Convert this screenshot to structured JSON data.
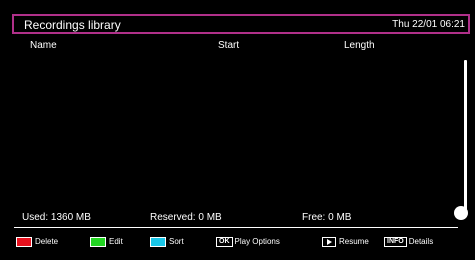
{
  "header": {
    "title": "Recordings library",
    "clock": "Thu 22/01 06:21"
  },
  "columns": {
    "name": "Name",
    "start": "Start",
    "length": "Length"
  },
  "recordings": [],
  "storage": {
    "used": "Used: 1360 MB",
    "reserved": "Reserved: 0 MB",
    "free": "Free: 0 MB"
  },
  "legend": {
    "delete": {
      "label": "Delete",
      "color": "#e8111e"
    },
    "edit": {
      "label": "Edit",
      "color": "#22d422"
    },
    "sort": {
      "label": "Sort",
      "color": "#19c6e8"
    },
    "play_options": {
      "key": "OK",
      "label": "Play Options"
    },
    "resume": {
      "key_icon": "play-icon",
      "label": "Resume"
    },
    "details": {
      "key": "INFO",
      "label": "Details"
    }
  },
  "colors": {
    "title_border": "#b0308a",
    "background": "#000000",
    "text": "#ffffff"
  }
}
